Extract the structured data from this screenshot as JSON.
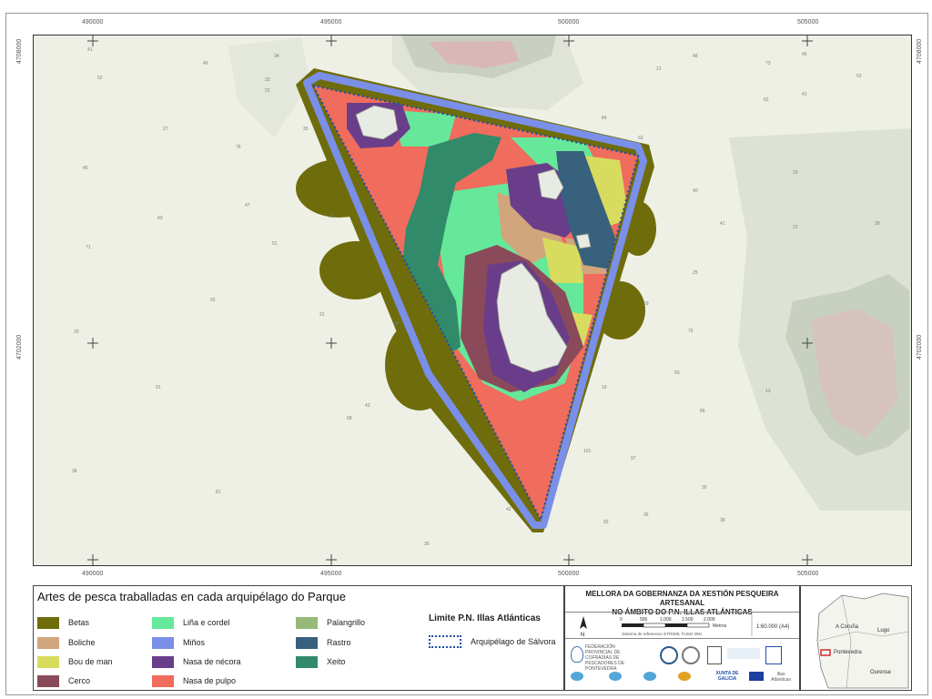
{
  "map": {
    "coords_top": [
      "490000",
      "495000",
      "500000",
      "505000"
    ],
    "coords_bottom": [
      "490000",
      "495000",
      "500000",
      "505000"
    ],
    "coords_left": [
      "4708000",
      "4702000"
    ],
    "coords_right": [
      "4708000",
      "4702000"
    ],
    "soundings": [
      "41",
      "52",
      "49",
      "34",
      "32",
      "22",
      "35",
      "31",
      "47",
      "76",
      "27",
      "45",
      "71",
      "55",
      "43",
      "51",
      "31",
      "84",
      "42",
      "91",
      "33",
      "68",
      "38",
      "81",
      "35",
      "42",
      "101",
      "97",
      "86",
      "26",
      "21",
      "48",
      "73",
      "62",
      "41",
      "29",
      "41",
      "31",
      "28",
      "45",
      "52",
      "25",
      "75",
      "69",
      "16",
      "13",
      "36",
      "38",
      "92",
      "84",
      "63",
      "40",
      "50"
    ]
  },
  "legend": {
    "title": "Artes de pesca traballadas en cada arquipélago do Parque",
    "items": [
      {
        "label": "Betas",
        "color": "#6f6c0b"
      },
      {
        "label": "Boliche",
        "color": "#d2a67d"
      },
      {
        "label": "Bou de man",
        "color": "#d7dc5e"
      },
      {
        "label": "Cerco",
        "color": "#8b4a5a"
      },
      {
        "label": "Liña e cordel",
        "color": "#66e89a"
      },
      {
        "label": "Miños",
        "color": "#7a8fe8"
      },
      {
        "label": "Nasa de nécora",
        "color": "#6a3d8a"
      },
      {
        "label": "Nasa de pulpo",
        "color": "#f06c5c"
      },
      {
        "label": "Palangrillo",
        "color": "#96b978"
      },
      {
        "label": "Rastro",
        "color": "#37617c"
      },
      {
        "label": "Xeito",
        "color": "#318a6a"
      }
    ],
    "limit_title": "Limite P.N. Illas Atlánticas",
    "limit_item": "Arquipélago de Sálvora"
  },
  "titleblock": {
    "line1": "MELLORA DA GOBERNANZA DA XESTIÓN PESQUEIRA ARTESANAL",
    "line2": "NO ÁMBITO DO P.N. ILLAS ATLÁNTICAS",
    "north": "N",
    "scale_ticks": [
      "0",
      "500",
      "1.000",
      "1.500",
      "2.000"
    ],
    "scale_unit": "Metros",
    "crs": "Sistema de referencia: ETRS89, FUSO 29N",
    "scale_ratio": "1:60.000 (A4)",
    "logos": [
      "FEDERACIÓN PROVINCIAL DE COFRADÍAS DE PESCADORES DE PONTEVEDRA",
      "XUNTA DE GALICIA",
      "Rías Baixas",
      "Illas Atlánticas"
    ]
  },
  "inset": {
    "labels": [
      "A Coruña",
      "Lugo",
      "Pontevedra",
      "Ourense"
    ]
  }
}
